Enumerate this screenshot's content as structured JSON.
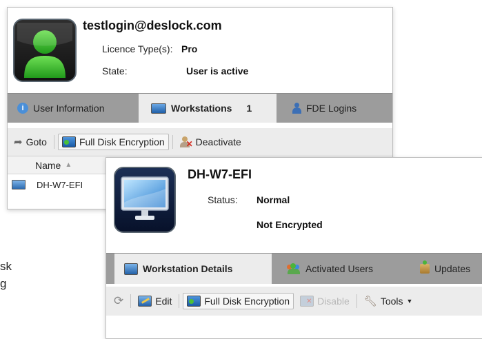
{
  "user": {
    "email": "testlogin@deslock.com",
    "licence_label": "Licence Type(s):",
    "licence_value": "Pro",
    "state_label": "State:",
    "state_value": "User is active",
    "tabs": [
      {
        "label": "User Information",
        "badge": "",
        "icon": "info-icon"
      },
      {
        "label": "Workstations",
        "badge": "1",
        "icon": "monitor-icon"
      },
      {
        "label": "FDE Logins",
        "badge": "",
        "icon": "person-icon"
      }
    ],
    "toolbar": {
      "goto": "Goto",
      "fde": "Full Disk Encryption",
      "deactivate": "Deactivate"
    },
    "grid": {
      "name_header": "Name",
      "rows": [
        {
          "name": "DH-W7-EFI"
        }
      ]
    }
  },
  "workstation": {
    "name": "DH-W7-EFI",
    "status_label": "Status:",
    "status_value": "Normal",
    "encryption_value": "Not Encrypted",
    "tabs": [
      {
        "label": "Workstation Details",
        "icon": "monitor-icon"
      },
      {
        "label": "Activated Users",
        "icon": "users-icon"
      },
      {
        "label": "Updates",
        "icon": "box-icon"
      }
    ],
    "toolbar": {
      "edit": "Edit",
      "fde": "Full Disk Encryption",
      "disable": "Disable",
      "tools": "Tools"
    }
  },
  "background_text": {
    "line1": "sk",
    "line2": "g"
  },
  "colors": {
    "tab_bar": "#9c9c9c",
    "active_tab": "#ececec",
    "avatar_green": "#3fbf2f",
    "monitor_blue": "#1d6fbf"
  }
}
